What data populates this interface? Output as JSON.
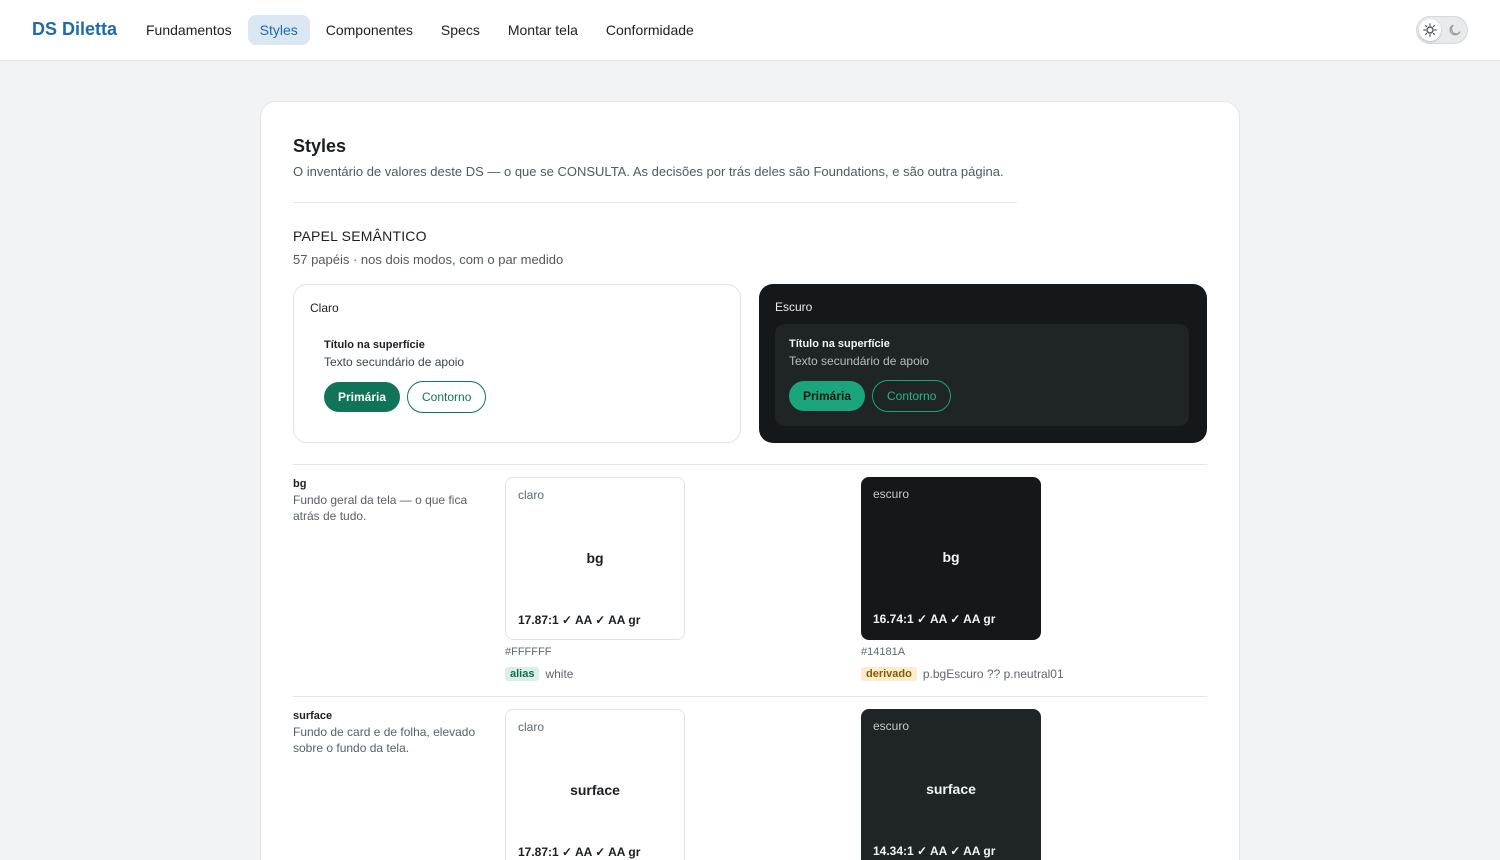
{
  "brand": "DS Diletta",
  "nav": [
    {
      "label": "Fundamentos",
      "active": false
    },
    {
      "label": "Styles",
      "active": true
    },
    {
      "label": "Componentes",
      "active": false
    },
    {
      "label": "Specs",
      "active": false
    },
    {
      "label": "Montar tela",
      "active": false
    },
    {
      "label": "Conformidade",
      "active": false
    }
  ],
  "theme_toggle": {
    "light_icon": "sun-icon",
    "dark_icon": "moon-icon"
  },
  "page": {
    "title": "Styles",
    "subtitle": "O inventário de valores deste DS — o que se CONSULTA. As decisões por trás deles são Foundations, e são outra página."
  },
  "section": {
    "title": "PAPEL SEMÂNTICO",
    "meta": "57 papéis · nos dois modos, com o par medido"
  },
  "previews": {
    "light": {
      "label": "Claro",
      "title": "Título na superfície",
      "text": "Texto secundário de apoio",
      "primary": "Primária",
      "outline": "Contorno"
    },
    "dark": {
      "label": "Escuro",
      "title": "Título na superfície",
      "text": "Texto secundário de apoio",
      "primary": "Primária",
      "outline": "Contorno"
    }
  },
  "tokens": [
    {
      "name": "bg",
      "description": "Fundo geral da tela — o que fica atrás de tudo.",
      "light": {
        "mode": "claro",
        "label": "bg",
        "ratio": "17.87:1 ✓ AA ✓ AA gr",
        "hex": "#FFFFFF",
        "tag": "alias",
        "source": "white",
        "color": "#FFFFFF"
      },
      "dark": {
        "mode": "escuro",
        "label": "bg",
        "ratio": "16.74:1 ✓ AA ✓ AA gr",
        "hex": "#14181A",
        "tag": "derivado",
        "source": "p.bgEscuro ?? p.neutral01",
        "color": "#14181A"
      }
    },
    {
      "name": "surface",
      "description": "Fundo de card e de folha, elevado sobre o fundo da tela.",
      "light": {
        "mode": "claro",
        "label": "surface",
        "ratio": "17.87:1 ✓ AA ✓ AA gr",
        "color": "#FFFFFF"
      },
      "dark": {
        "mode": "escuro",
        "label": "surface",
        "ratio": "14.34:1 ✓ AA ✓ AA gr",
        "color": "#1F2426"
      }
    }
  ]
}
